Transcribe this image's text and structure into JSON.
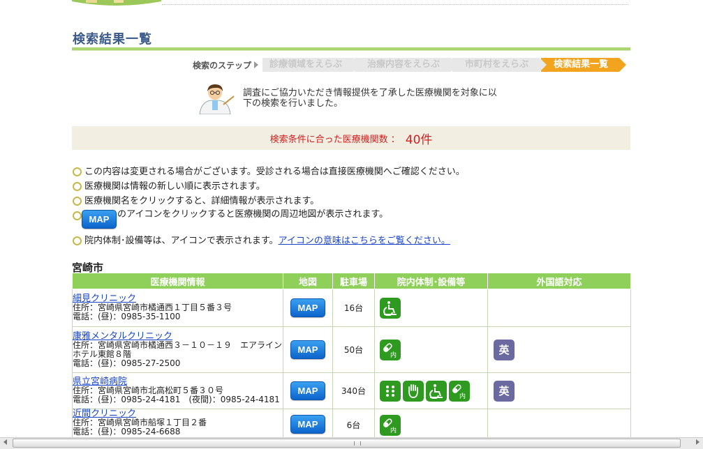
{
  "page_title": "検索結果一覧",
  "steps": {
    "label": "検索のステップ",
    "items": [
      "診療領域をえらぶ",
      "治療内容をえらぶ",
      "市町村をえらぶ",
      "検索結果一覧"
    ]
  },
  "intro": {
    "line1": "調査にご協力いただき情報提供を了承した医療機関を対象に以",
    "line2": "下の検索を行いました。"
  },
  "result_count": {
    "label": "検索条件に合った医療機関数 ：",
    "value": "40件"
  },
  "notes": {
    "n1": "この内容は変更される場合がございます。受診される場合は直接医療機関へご確認ください。",
    "n2": "医療機関は情報の新しい順に表示されます。",
    "n3": "医療機関名をクリックすると、詳細情報が表示されます。",
    "n4_map": "MAP",
    "n4": "のアイコンをクリックすると医療機関の周辺地図が表示されます。",
    "n5": "院内体制･設備等は、アイコンで表示されます。",
    "n5_link": "アイコンの意味はこちらをご覧ください。"
  },
  "city": "宮崎市",
  "table": {
    "headers": [
      "医療機関情報",
      "地図",
      "駐車場",
      "院内体制･設備等",
      "外国語対応"
    ],
    "map_label": "MAP",
    "rows": [
      {
        "name": "細見クリニック",
        "address": "住所：宮崎県宮崎市橘通西１丁目５番３号",
        "phone": "電話：(昼)：0985-35-1100",
        "parking": "16台",
        "equipment": [
          "wheelchair-icon"
        ],
        "language": ""
      },
      {
        "name": "康雅メンタルクリニック",
        "address": "住所：宮崎県宮崎市橘通西３－１０－１９　エアラインホテル東館８階",
        "phone": "電話：(昼)：0985-27-2500",
        "parking": "50台",
        "equipment": [
          "medicine-internal-icon"
        ],
        "language": "英"
      },
      {
        "name": "県立宮崎病院",
        "address": "住所：宮崎県宮崎市北高松町５番３０号",
        "phone": "電話：(昼)：0985-24-4181　(夜間)：0985-24-4181",
        "parking": "340台",
        "equipment": [
          "braille-icon",
          "sign-language-icon",
          "wheelchair-icon",
          "medicine-internal-icon"
        ],
        "language": "英"
      },
      {
        "name": "近間クリニック",
        "address": "住所：宮崎県宮崎市船塚１丁目２番",
        "phone": "電話：(昼)：0985-24-6688",
        "parking": "6台",
        "equipment": [
          "medicine-internal-icon"
        ],
        "language": ""
      }
    ]
  },
  "colors": {
    "accent_green": "#8fd05a",
    "step_active": "#f3a41f",
    "count_red": "#d42020",
    "map_blue": "#0b64cc",
    "equipment_green": "#2e9a20",
    "language_purple": "#6a6aa0"
  }
}
